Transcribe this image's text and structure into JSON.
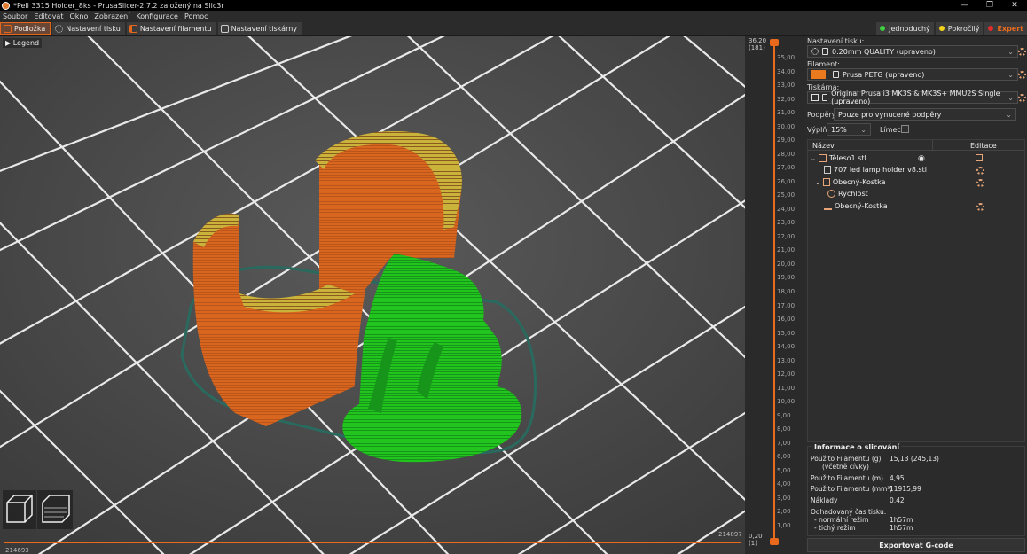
{
  "window": {
    "title": "*Peli 3315 Holder_8ks - PrusaSlicer-2.7.2 založený na Slic3r",
    "controls": [
      "—",
      "❐",
      "✕"
    ]
  },
  "menu": [
    "Soubor",
    "Editovat",
    "Okno",
    "Zobrazení",
    "Konfigurace",
    "Pomoc"
  ],
  "tabs": [
    "Podložka",
    "Nastavení tisku",
    "Nastavení filamentu",
    "Nastavení tiskárny"
  ],
  "modes": [
    {
      "label": "Jednoduchý",
      "color": "#3ecf3e"
    },
    {
      "label": "Pokročilý",
      "color": "#f2d21a"
    },
    {
      "label": "Expert",
      "color": "#e02b2b"
    }
  ],
  "viewport": {
    "legend": "Legend",
    "h_slider_right": "214897",
    "h_slider_left": "214693"
  },
  "layer_slider": {
    "top_value": "36,20",
    "top_layer": "(181)",
    "bottom_value": "0,20",
    "bottom_layer": "(1)",
    "ticks": [
      "35,00",
      "34,00",
      "33,00",
      "32,00",
      "31,00",
      "30,00",
      "29,00",
      "28,00",
      "27,00",
      "26,00",
      "25,00",
      "24,00",
      "23,00",
      "22,00",
      "21,00",
      "20,00",
      "19,00",
      "18,00",
      "17,00",
      "16,00",
      "15,00",
      "14,00",
      "13,00",
      "12,00",
      "11,00",
      "10,00",
      "9,00",
      "8,00",
      "7,00",
      "6,00",
      "5,00",
      "4,00",
      "3,00",
      "2,00",
      "1,00"
    ]
  },
  "sidebar": {
    "print_settings_label": "Nastavení tisku:",
    "print_settings_value": "0.20mm QUALITY (upraveno)",
    "filament_label": "Filament:",
    "filament_value": "Prusa PETG (upraveno)",
    "filament_color": "#ea7a1d",
    "printer_label": "Tiskárna:",
    "printer_value": "Original Prusa i3 MK3S & MK3S+ MMU2S Single (upraveno)",
    "supports_label": "Podpěry:",
    "supports_value": "Pouze pro vynucené podpěry",
    "infill_label": "Výplň:",
    "infill_value": "15%",
    "brim_label": "Límec:",
    "list_header_name": "Název",
    "list_header_edit": "Editace",
    "objects": [
      {
        "label": "Těleso1.stl",
        "indent": 0
      },
      {
        "label": "707 led lamp holder v8.stl",
        "indent": 1
      },
      {
        "label": "Obecný-Kostka",
        "indent": 1
      },
      {
        "label": "Rychlost",
        "indent": 2
      },
      {
        "label": "Obecný-Kostka",
        "indent": 1
      }
    ],
    "info": {
      "title": "Informace o slicování",
      "filament_g_label": "Použito Filamentu (g)",
      "filament_g_sub": "(včetně cívky)",
      "filament_g_value": "15,13 (245,13)",
      "filament_m_label": "Použito Filamentu (m)",
      "filament_m_value": "4,95",
      "filament_mm3_label": "Použito Filamentu (mm³)",
      "filament_mm3_value": "11915,99",
      "cost_label": "Náklady",
      "cost_value": "0,42",
      "time_label": "Odhadovaný čas tisku:",
      "normal_label": "- normální režim",
      "normal_value": "1h57m",
      "silent_label": "- tichý režim",
      "silent_value": "1h57m"
    },
    "export_label": "Exportovat G-code"
  }
}
